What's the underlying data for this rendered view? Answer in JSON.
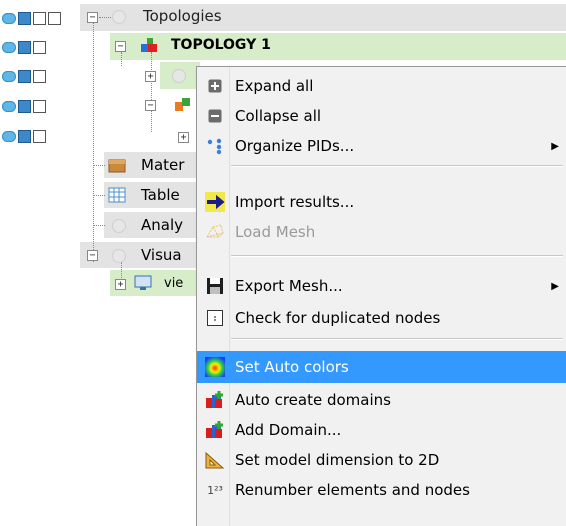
{
  "tree": {
    "topologies_label": "Topologies",
    "topology1_label": "TOPOLOGY 1",
    "materials_label": "Mater",
    "tables_label": "Table",
    "analysis_label": "Analy",
    "visual_label": "Visua",
    "view_label": "vie"
  },
  "menu": {
    "items": [
      {
        "label": "Expand all",
        "icon": "expand-icon"
      },
      {
        "label": "Collapse all",
        "icon": "collapse-icon"
      },
      {
        "label": "Organize PIDs...",
        "icon": "organize-icon",
        "submenu": true
      },
      {
        "label": "Import results...",
        "icon": "import-arrow-icon"
      },
      {
        "label": "Load Mesh",
        "icon": "load-mesh-icon",
        "disabled": true
      },
      {
        "label": "Export Mesh...",
        "icon": "save-disk-icon",
        "submenu": true
      },
      {
        "label": "Check for duplicated nodes",
        "icon": "check-nodes-icon"
      },
      {
        "label": "Set Auto colors",
        "icon": "color-gradient-icon",
        "highlighted": true
      },
      {
        "label": "Auto create domains",
        "icon": "domain-add-icon"
      },
      {
        "label": "Add Domain...",
        "icon": "domain-add-icon"
      },
      {
        "label": "Set model dimension to 2D",
        "icon": "set-square-icon"
      },
      {
        "label": "Renumber elements and nodes",
        "icon": "renumber-icon"
      }
    ],
    "renumber_glyph": "1²³",
    "submenu_arrow": "▶",
    "highlight_color": "#3399ff"
  }
}
